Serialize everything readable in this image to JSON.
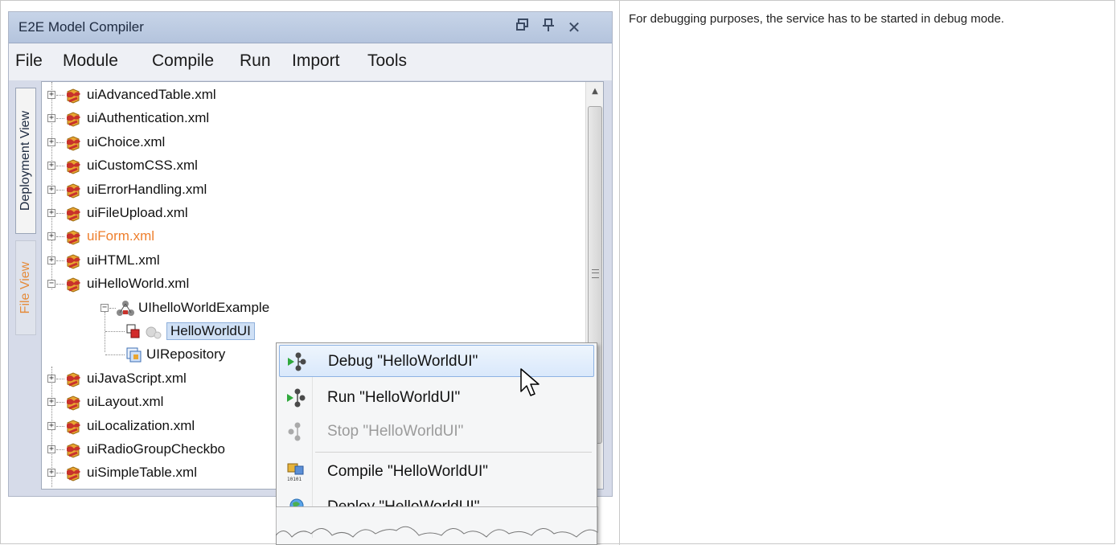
{
  "window": {
    "title": "E2E Model Compiler",
    "restore_icon": "restore-icon",
    "pin_icon": "pin-icon",
    "close_icon": "close-icon",
    "close_glyph": "✕",
    "pin_glyph": "🖈"
  },
  "menu": [
    "File",
    "Module",
    "Compile",
    "Run",
    "Import",
    "Tools"
  ],
  "tabs": {
    "deployment": "Deployment View",
    "file": "File View"
  },
  "tree": {
    "items": [
      "uiAdvancedTable.xml",
      "uiAuthentication.xml",
      "uiChoice.xml",
      "uiCustomCSS.xml",
      "uiErrorHandling.xml",
      "uiFileUpload.xml",
      "uiForm.xml",
      "uiHTML.xml",
      "uiHelloWorld.xml",
      "UIhelloWorldExample",
      "HelloWorldUI",
      "UIRepository",
      "uiJavaScript.xml",
      "uiLayout.xml",
      "uiLocalization.xml",
      "uiRadioGroupCheckbo",
      "uiSimpleTable.xml"
    ]
  },
  "context_menu": {
    "debug": "Debug \"HelloWorldUI\"",
    "run": "Run \"HelloWorldUI\"",
    "stop": "Stop \"HelloWorldUI\"",
    "compile": "Compile \"HelloWorldUI\"",
    "deploy": "Deploy \"HelloWorldUI\""
  },
  "description": "For debugging purposes, the service has to be started in debug mode.",
  "colors": {
    "accent_orange": "#ee7f2d",
    "selection": "#cfe0f5",
    "titlebar": "#b4c4dd"
  }
}
